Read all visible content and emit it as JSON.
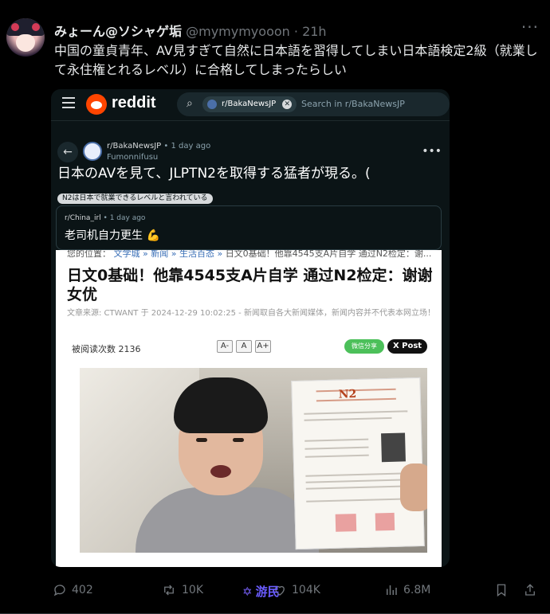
{
  "tweet": {
    "display_name": "みょーん@ソシャゲ垢",
    "handle": "@mymymyooon",
    "separator": "·",
    "time": "21h",
    "more": "···",
    "text": "中国の童貞青年、AV見すぎて自然に日本語を習得してしまい日本語検定2級（就業して永住権とれるレベル）に合格してしまったらしい"
  },
  "embed": {
    "reddit": {
      "wordmark": "reddit",
      "search_chip": "r/BakaNewsJP",
      "search_placeholder": "Search in r/BakaNewsJP",
      "subreddit": "r/BakaNewsJP",
      "post_meta": "• 1 day ago",
      "username": "Fumonnifusu",
      "post_more": "•••",
      "post_title": "日本のAVを見て、JLPTN2を取得する猛者が現る。(",
      "flair": "N2は日本で就業できるレベルと言われている",
      "quote": {
        "subreddit": "r/China_irl",
        "meta": "• 1 day ago",
        "text": "老司机自力更生 💪"
      }
    },
    "article": {
      "breadcrumb_prefix": "您的位置：",
      "breadcrumb_links": "文学城 » 新闻 » 生活百态 »",
      "breadcrumb_rest": "日文0基础！他靠4545支A片自学 通过N2检定：谢...",
      "headline": "日文0基础！他靠4545支A片自学 通过N2检定：谢谢女优",
      "source": "文章来源: CTWANT 于 2024-12-29 10:02:25 - 新闻取自各大新闻媒体，新闻内容并不代表本网立场！",
      "views": "被阅读次数 2136",
      "font_buttons": [
        "A-",
        "A",
        "A+"
      ],
      "wechat_share": "微信分享",
      "x_post": "X Post",
      "cert_title": "N2"
    }
  },
  "actions": {
    "replies": "402",
    "reposts": "10K",
    "likes": "104K",
    "views": "6.8M",
    "watermark": "游民"
  },
  "icons": {
    "reply": "reply-icon",
    "repost": "repost-icon",
    "like": "heart-icon",
    "views": "views-icon",
    "bookmark": "bookmark-icon",
    "share": "share-icon"
  }
}
